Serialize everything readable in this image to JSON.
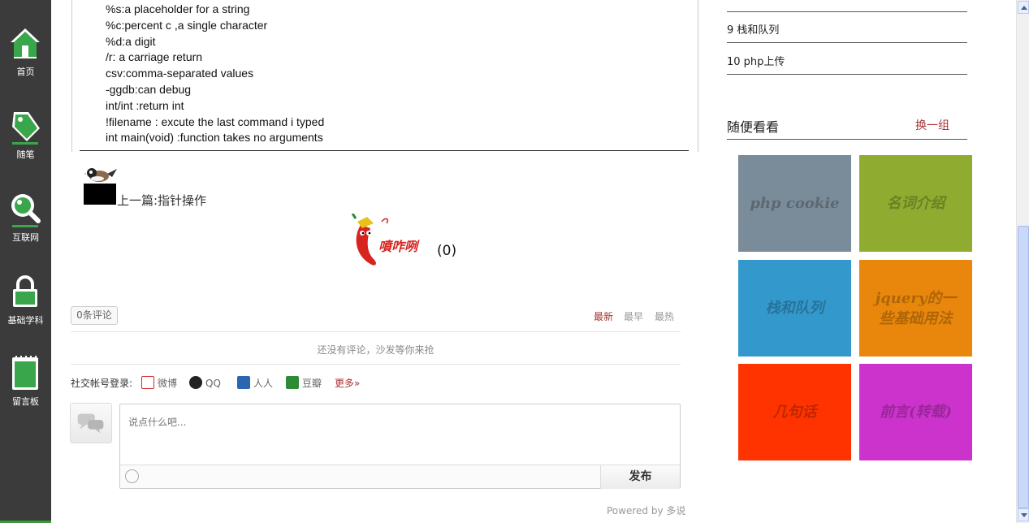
{
  "nav": {
    "items": [
      {
        "label": "首页",
        "icon": "home-icon"
      },
      {
        "label": "随笔",
        "icon": "tag-pen-icon"
      },
      {
        "label": "互联网",
        "icon": "magnifier-icon"
      },
      {
        "label": "基础学科",
        "icon": "lock-icon"
      },
      {
        "label": "留言板",
        "icon": "notepad-icon"
      }
    ]
  },
  "article": {
    "lines": [
      "%s:a placeholder for a string",
      "%c:percent c ,a single character",
      "%d:a digit",
      "/r: a carriage return",
      "csv:comma-separated values",
      "-ggdb:can debug",
      "int/int :return int",
      "!filename : excute the last command i typed",
      "int main(void) :function takes no arguments"
    ],
    "prev_link": "上一篇:指针操作",
    "reaction": {
      "label": "噴咋咧",
      "count": "(0)"
    }
  },
  "comments": {
    "count_label": "0条评论",
    "sort": [
      "最新",
      "最早",
      "最热"
    ],
    "empty_message": "还没有评论，沙发等你来抢",
    "social_label": "社交帐号登录:",
    "social": [
      {
        "label": "微博",
        "color": "#d52b2b"
      },
      {
        "label": "QQ",
        "color": "#3d6fb8"
      },
      {
        "label": "人人",
        "color": "#2a66b1"
      },
      {
        "label": "豆瓣",
        "color": "#2e8b33"
      }
    ],
    "more": "更多»",
    "placeholder": "说点什么吧...",
    "submit": "发布",
    "powered": "Powered by 多说"
  },
  "sidebar": {
    "list": [
      "9 栈和队列",
      "10 php上传"
    ],
    "random_title": "随便看看",
    "swap": "换一组",
    "tiles": [
      {
        "label": "php cookie",
        "color": "#7a8b99"
      },
      {
        "label": "名词介绍",
        "color": "#8fac30"
      },
      {
        "label": "栈和队列",
        "color": "#3399cc"
      },
      {
        "label": "jquery的一些基础用法",
        "color": "#e8870b"
      },
      {
        "label": "几句话",
        "color": "#ff3300"
      },
      {
        "label": "前言(转载)",
        "color": "#cc33cc"
      }
    ]
  }
}
